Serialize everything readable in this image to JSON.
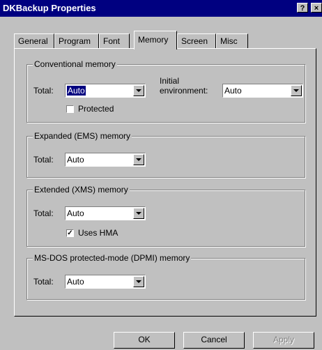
{
  "window": {
    "title": "DKBackup Properties",
    "help_label": "?",
    "close_label": "×"
  },
  "tabs": [
    {
      "label": "General"
    },
    {
      "label": "Program"
    },
    {
      "label": "Font"
    },
    {
      "label": "Memory",
      "active": true
    },
    {
      "label": "Screen"
    },
    {
      "label": "Misc"
    }
  ],
  "conventional": {
    "legend": "Conventional memory",
    "total_label": "Total:",
    "total_value": "Auto",
    "initial_label_1": "Initial",
    "initial_label_2": "environment:",
    "initial_value": "Auto",
    "protected_label": "Protected",
    "protected_checked": false
  },
  "ems": {
    "legend": "Expanded (EMS) memory",
    "total_label": "Total:",
    "total_value": "Auto"
  },
  "xms": {
    "legend": "Extended (XMS) memory",
    "total_label": "Total:",
    "total_value": "Auto",
    "hma_label": "Uses HMA",
    "hma_checked": true
  },
  "dpmi": {
    "legend": "MS-DOS protected-mode (DPMI) memory",
    "total_label": "Total:",
    "total_value": "Auto"
  },
  "buttons": {
    "ok": "OK",
    "cancel": "Cancel",
    "apply": "Apply"
  }
}
